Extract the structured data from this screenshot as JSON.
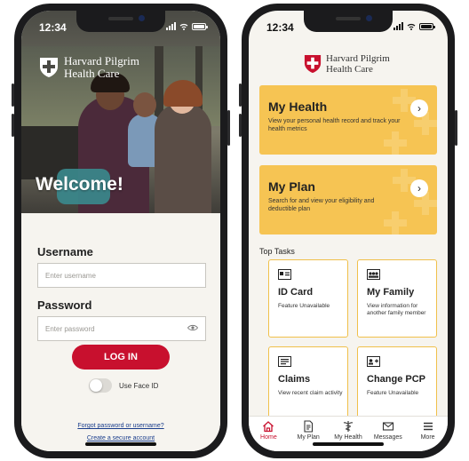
{
  "colors": {
    "brand_red": "#c8102e",
    "card_yellow": "#f6c453",
    "task_border": "#f0c04a",
    "form_bg": "#f6f4ef",
    "link_blue": "#1a3d8c"
  },
  "login_screen": {
    "status_time": "12:34",
    "brand_line1": "Harvard Pilgrim",
    "brand_line2": "Health Care",
    "welcome": "Welcome!",
    "username_label": "Username",
    "username_placeholder": "Enter username",
    "password_label": "Password",
    "password_placeholder": "Enter password",
    "login_button": "LOG IN",
    "face_id_label": "Use Face ID",
    "forgot_link": "Forgot password or username?",
    "create_link": "Create a secure account",
    "icons": [
      "logo-shield-icon",
      "eye-icon",
      "signal-icon",
      "wifi-icon",
      "battery-icon"
    ]
  },
  "home_screen": {
    "status_time": "12:34",
    "brand_line1": "Harvard Pilgrim",
    "brand_line2": "Health Care",
    "cards": [
      {
        "title": "My Health",
        "desc": "View your personal health record and track your health metrics"
      },
      {
        "title": "My Plan",
        "desc": "Search for and view your eligibility and deductible plan"
      }
    ],
    "top_tasks_title": "Top Tasks",
    "tasks": [
      {
        "title": "ID Card",
        "desc": "Feature Unavailable",
        "icon": "id-card-icon"
      },
      {
        "title": "My Family",
        "desc": "View information for another family member",
        "icon": "family-icon"
      },
      {
        "title": "Claims",
        "desc": "View recent claim activity",
        "icon": "claims-icon"
      },
      {
        "title": "Change PCP",
        "desc": "Feature Unavailable",
        "icon": "change-pcp-icon"
      }
    ],
    "tabs": [
      {
        "label": "Home",
        "icon": "home-icon",
        "active": true
      },
      {
        "label": "My Plan",
        "icon": "document-icon"
      },
      {
        "label": "My Health",
        "icon": "caduceus-icon"
      },
      {
        "label": "Messages",
        "icon": "envelope-icon"
      },
      {
        "label": "More",
        "icon": "menu-icon"
      }
    ]
  }
}
